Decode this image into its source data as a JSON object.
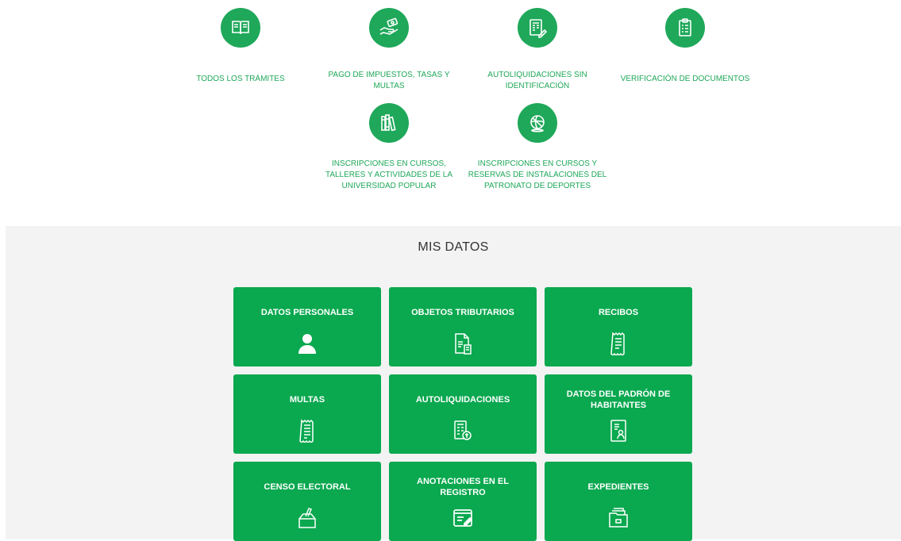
{
  "services": [
    {
      "label": "TODOS LOS TRÁMITES",
      "icon": "book-icon"
    },
    {
      "label": "PAGO DE IMPUESTOS, TASAS Y MULTAS",
      "icon": "hand-money-icon"
    },
    {
      "label": "AUTOLIQUIDACIONES SIN IDENTIFICACIÓN",
      "icon": "calculator-document-icon"
    },
    {
      "label": "VERIFICACIÓN DE DOCUMENTOS",
      "icon": "clipboard-check-icon"
    },
    {
      "label": "INSCRIPCIONES EN CURSOS, TALLERES Y ACTIVIDADES DE LA UNIVERSIDAD POPULAR",
      "icon": "books-icon"
    },
    {
      "label": "INSCRIPCIONES EN CURSOS Y RESERVAS DE INSTALACIONES DEL PATRONATO DE DEPORTES",
      "icon": "sports-ball-icon"
    }
  ],
  "mis_datos": {
    "title": "MIS DATOS",
    "tiles": [
      {
        "label": "DATOS PERSONALES",
        "icon": "user-icon"
      },
      {
        "label": "OBJETOS TRIBUTARIOS",
        "icon": "tax-document-icon"
      },
      {
        "label": "RECIBOS",
        "icon": "receipt-icon"
      },
      {
        "label": "MULTAS",
        "icon": "ticket-icon"
      },
      {
        "label": "AUTOLIQUIDACIONES",
        "icon": "calculator-icon"
      },
      {
        "label": "DATOS DEL PADRÓN DE HABITANTES",
        "icon": "id-document-icon"
      },
      {
        "label": "CENSO ELECTORAL",
        "icon": "ballot-box-icon"
      },
      {
        "label": "ANOTACIONES EN EL REGISTRO",
        "icon": "register-edit-icon"
      },
      {
        "label": "EXPEDIENTES",
        "icon": "folder-icon"
      }
    ]
  },
  "colors": {
    "accent": "#1fa85a",
    "tile": "#0aa84f",
    "section_bg": "#f3f3f3"
  }
}
